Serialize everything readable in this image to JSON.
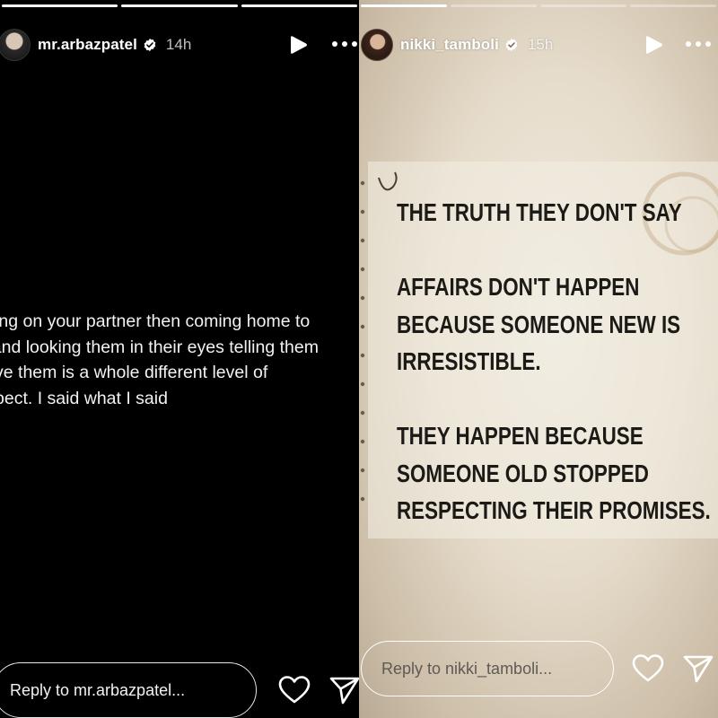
{
  "left_story": {
    "username": "mr.arbazpatel",
    "time": "14h",
    "progress": {
      "segments": 3,
      "current": 3
    },
    "text_lines": [
      "Cheating on your partner then coming home to",
      "them and looking them in their eyes telling them",
      "you love them is a whole different level of",
      "disrespect. I said what I said"
    ],
    "reply_placeholder": "Reply to mr.arbazpatel..."
  },
  "right_story": {
    "username": "nikki_tamboli",
    "time": "15h",
    "progress": {
      "segments": 4,
      "current": 1
    },
    "quote_lines": [
      "THE TRUTH THEY DON'T SAY",
      "",
      "AFFAIRS DON'T HAPPEN",
      "BECAUSE SOMEONE NEW IS",
      "IRRESISTIBLE.",
      "",
      "THEY HAPPEN BECAUSE",
      "SOMEONE OLD STOPPED",
      "RESPECTING THEIR PROMISES."
    ],
    "reply_placeholder": "Reply to nikki_tamboli..."
  },
  "icons": {
    "verified": "verified-badge-icon",
    "play": "play-icon",
    "more": "more-options-icon",
    "like": "heart-icon",
    "share": "send-icon"
  }
}
